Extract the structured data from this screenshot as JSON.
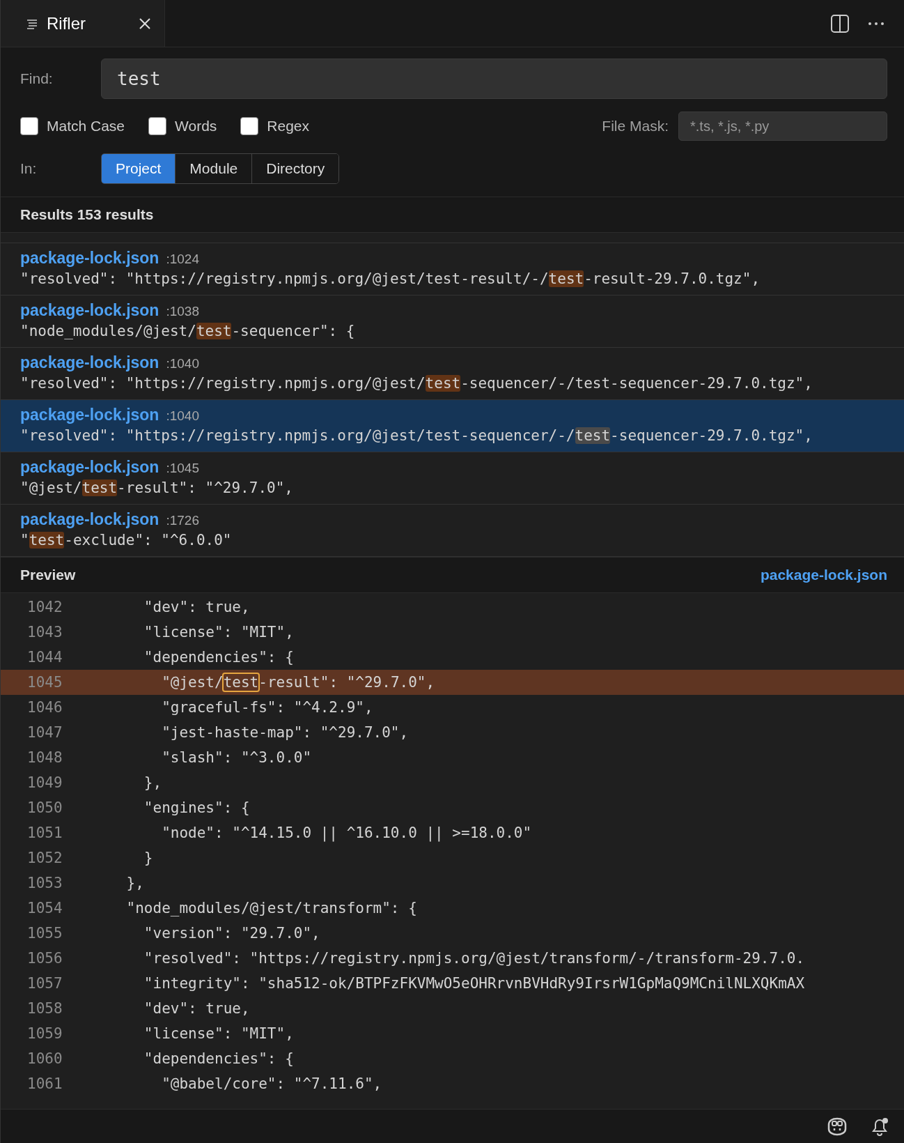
{
  "tab": {
    "title": "Rifler"
  },
  "find": {
    "label": "Find:",
    "value": "test"
  },
  "options": [
    {
      "label": "Match Case",
      "checked": false
    },
    {
      "label": "Words",
      "checked": false
    },
    {
      "label": "Regex",
      "checked": false
    }
  ],
  "file_mask": {
    "label": "File Mask:",
    "placeholder": "*.ts, *.js, *.py"
  },
  "scope": {
    "label": "In:",
    "options": [
      {
        "label": "Project",
        "selected": true
      },
      {
        "label": "Module",
        "selected": false
      },
      {
        "label": "Directory",
        "selected": false
      }
    ]
  },
  "results": {
    "title": "Results 153 results",
    "items": [
      {
        "file": "package-lock.json",
        "line": ":1024",
        "before": "\"resolved\": \"https://registry.npmjs.org/@jest/test-result/-/",
        "match": "test",
        "after": "-result-29.7.0.tgz\",",
        "selected": false
      },
      {
        "file": "package-lock.json",
        "line": ":1038",
        "before": "\"node_modules/@jest/",
        "match": "test",
        "after": "-sequencer\": {",
        "selected": false
      },
      {
        "file": "package-lock.json",
        "line": ":1040",
        "before": "\"resolved\": \"https://registry.npmjs.org/@jest/",
        "match": "test",
        "after": "-sequencer/-/test-sequencer-29.7.0.tgz\",",
        "selected": false
      },
      {
        "file": "package-lock.json",
        "line": ":1040",
        "before": "\"resolved\": \"https://registry.npmjs.org/@jest/test-sequencer/-/",
        "match": "test",
        "after": "-sequencer-29.7.0.tgz\",",
        "selected": true
      },
      {
        "file": "package-lock.json",
        "line": ":1045",
        "before": "\"@jest/",
        "match": "test",
        "after": "-result\": \"^29.7.0\",",
        "selected": false
      },
      {
        "file": "package-lock.json",
        "line": ":1726",
        "before": "\"",
        "match": "test",
        "after": "-exclude\": \"^6.0.0\"",
        "selected": false
      }
    ]
  },
  "preview": {
    "title": "Preview",
    "file": "package-lock.json",
    "lines": [
      {
        "number": "1042",
        "text": "      \"dev\": true,",
        "current": false
      },
      {
        "number": "1043",
        "text": "      \"license\": \"MIT\",",
        "current": false
      },
      {
        "number": "1044",
        "text": "      \"dependencies\": {",
        "current": false
      },
      {
        "number": "1045",
        "text": "        \"@jest/",
        "match": "test",
        "after": "-result\": \"^29.7.0\",",
        "current": true
      },
      {
        "number": "1046",
        "text": "        \"graceful-fs\": \"^4.2.9\",",
        "current": false
      },
      {
        "number": "1047",
        "text": "        \"jest-haste-map\": \"^29.7.0\",",
        "current": false
      },
      {
        "number": "1048",
        "text": "        \"slash\": \"^3.0.0\"",
        "current": false
      },
      {
        "number": "1049",
        "text": "      },",
        "current": false
      },
      {
        "number": "1050",
        "text": "      \"engines\": {",
        "current": false
      },
      {
        "number": "1051",
        "text": "        \"node\": \"^14.15.0 || ^16.10.0 || >=18.0.0\"",
        "current": false
      },
      {
        "number": "1052",
        "text": "      }",
        "current": false
      },
      {
        "number": "1053",
        "text": "    },",
        "current": false
      },
      {
        "number": "1054",
        "text": "    \"node_modules/@jest/transform\": {",
        "current": false
      },
      {
        "number": "1055",
        "text": "      \"version\": \"29.7.0\",",
        "current": false
      },
      {
        "number": "1056",
        "text": "      \"resolved\": \"https://registry.npmjs.org/@jest/transform/-/transform-29.7.0.",
        "current": false
      },
      {
        "number": "1057",
        "text": "      \"integrity\": \"sha512-ok/BTPFzFKVMwO5eOHRrvnBVHdRy9IrsrW1GpMaQ9MCnilNLXQKmAX",
        "current": false
      },
      {
        "number": "1058",
        "text": "      \"dev\": true,",
        "current": false
      },
      {
        "number": "1059",
        "text": "      \"license\": \"MIT\",",
        "current": false
      },
      {
        "number": "1060",
        "text": "      \"dependencies\": {",
        "current": false
      },
      {
        "number": "1061",
        "text": "        \"@babel/core\": \"^7.11.6\",",
        "current": false
      }
    ]
  }
}
